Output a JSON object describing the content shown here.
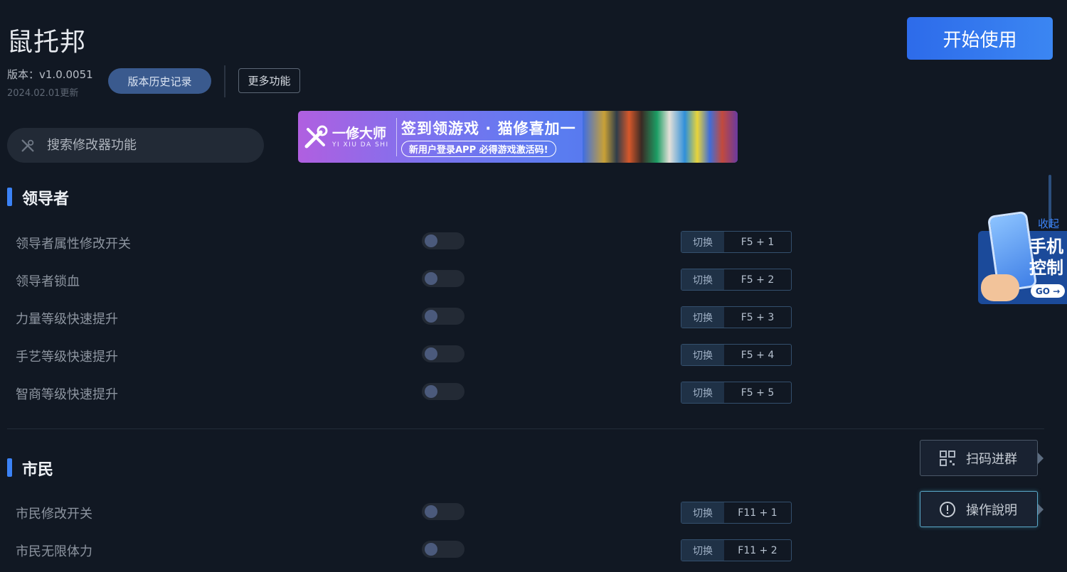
{
  "app": {
    "title": "鼠托邦",
    "version": "版本：v1.0.0051",
    "update_date": "2024.02.01更新",
    "history_label": "版本历史记录",
    "more_label": "更多功能",
    "start_label": "开始使用"
  },
  "search": {
    "placeholder": "搜索修改器功能"
  },
  "banner": {
    "brand_name": "一修大师",
    "brand_sub": "YI XIU DA SHI",
    "headline": "签到领游戏 · 猫修喜加一",
    "pill": "新用户登录APP  必得游戏激活码!"
  },
  "sections": [
    {
      "title": "领导者",
      "rows": [
        {
          "label": "领导者属性修改开关",
          "switch_label": "切换",
          "hotkey": "F5 + 1",
          "enabled": false
        },
        {
          "label": "领导者锁血",
          "switch_label": "切换",
          "hotkey": "F5 + 2",
          "enabled": false
        },
        {
          "label": "力量等级快速提升",
          "switch_label": "切换",
          "hotkey": "F5 + 3",
          "enabled": false
        },
        {
          "label": "手艺等级快速提升",
          "switch_label": "切换",
          "hotkey": "F5 + 4",
          "enabled": false
        },
        {
          "label": "智商等级快速提升",
          "switch_label": "切换",
          "hotkey": "F5 + 5",
          "enabled": false
        }
      ]
    },
    {
      "title": "市民",
      "rows": [
        {
          "label": "市民修改开关",
          "switch_label": "切换",
          "hotkey": "F11 + 1",
          "enabled": false
        },
        {
          "label": "市民无限体力",
          "switch_label": "切换",
          "hotkey": "F11 + 2",
          "enabled": false
        }
      ]
    }
  ],
  "side": {
    "collapse_label": "收起",
    "phone_line1": "手机",
    "phone_line2": "控制",
    "go_label": "GO →",
    "qr_label": "扫码进群",
    "help_label": "操作說明"
  },
  "colors": {
    "background": "#111823",
    "accent": "#3b82f6",
    "start_button": "#2d6bea"
  }
}
